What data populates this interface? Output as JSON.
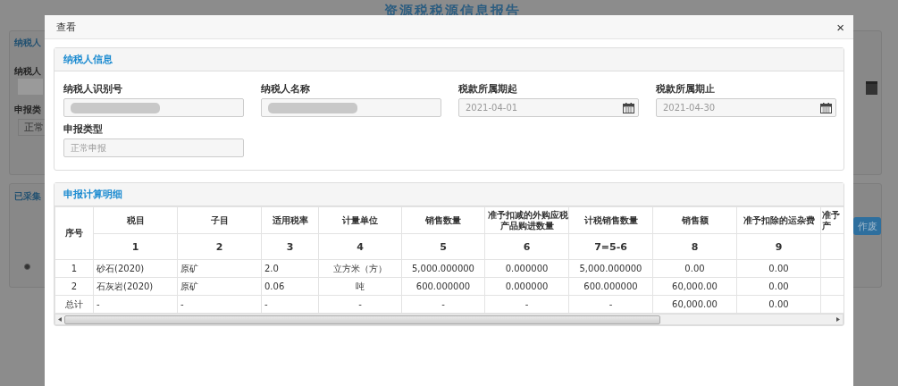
{
  "background": {
    "title": "资源税税源信息报告",
    "panel_header": "纳税人",
    "field_label": "纳税人",
    "type_label": "申报类",
    "type_value": "正常",
    "collected_header": "已采集",
    "void_button": "作废",
    "radio": {
      "selected": true
    }
  },
  "dialog": {
    "title": "查看",
    "close": "×"
  },
  "taxpayer_panel": {
    "title": "纳税人信息",
    "fields": [
      {
        "label": "纳税人识别号",
        "kind": "redacted"
      },
      {
        "label": "纳税人名称",
        "kind": "redacted"
      },
      {
        "label": "税款所属期起",
        "kind": "date",
        "value": "2021-04-01"
      },
      {
        "label": "税款所属期止",
        "kind": "date",
        "value": "2021-04-30"
      },
      {
        "label": "申报类型",
        "kind": "text",
        "value": "正常申报"
      }
    ]
  },
  "detail_panel": {
    "title": "申报计算明细",
    "table": {
      "columns": [
        {
          "label": [
            "序号"
          ]
        },
        {
          "label": [
            "税目"
          ],
          "number": "1"
        },
        {
          "label": [
            "子目"
          ],
          "number": "2"
        },
        {
          "label": [
            "适用税率"
          ],
          "number": "3"
        },
        {
          "label": [
            "计量单位"
          ],
          "number": "4"
        },
        {
          "label": [
            "销售数量"
          ],
          "number": "5"
        },
        {
          "label": [
            "准予扣减的外购应税",
            "产品购进数量"
          ],
          "number": "6"
        },
        {
          "label": [
            "计税销售数量"
          ],
          "number": "7=5-6"
        },
        {
          "label": [
            "销售额"
          ],
          "number": "8"
        },
        {
          "label": [
            "准予扣除的运杂费"
          ],
          "number": "9"
        },
        {
          "label": [
            "准予",
            "产"
          ]
        }
      ],
      "rows": [
        [
          "1",
          "砂石(2020)",
          "原矿",
          "2.0",
          "立方米（方）",
          "5,000.000000",
          "0.000000",
          "5,000.000000",
          "0.00",
          "0.00",
          ""
        ],
        [
          "2",
          "石灰岩(2020)",
          "原矿",
          "0.06",
          "吨",
          "600.000000",
          "0.000000",
          "600.000000",
          "60,000.00",
          "0.00",
          ""
        ],
        [
          "总计",
          "-",
          "-",
          "-",
          "-",
          "-",
          "-",
          "-",
          "60,000.00",
          "0.00",
          ""
        ]
      ]
    }
  }
}
